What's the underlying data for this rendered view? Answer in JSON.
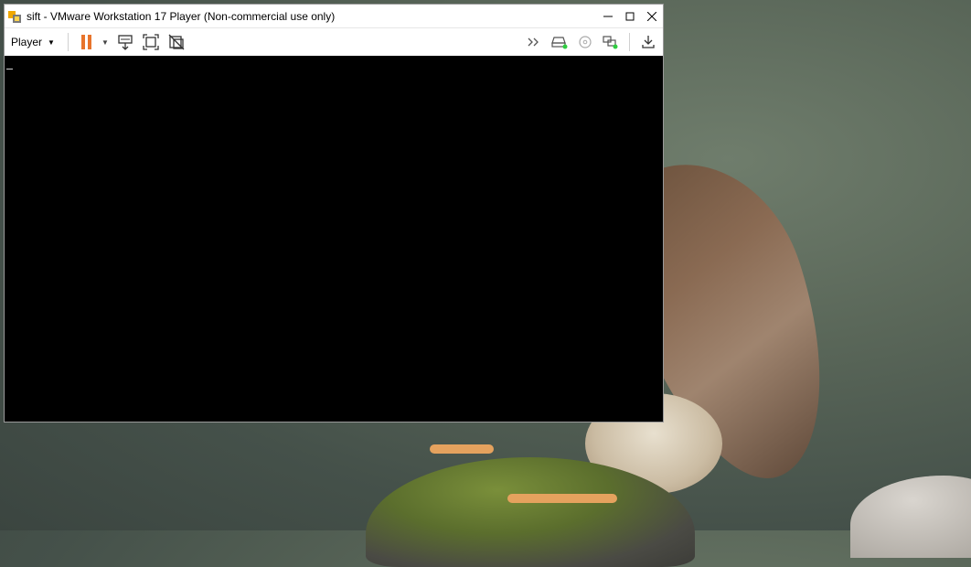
{
  "window": {
    "title": "sift - VMware Workstation 17 Player (Non-commercial use only)",
    "controls": {
      "minimize": "—",
      "maximize": "☐",
      "close": "✕"
    }
  },
  "toolbar": {
    "player_menu_label": "Player",
    "icons": [
      "pause-icon",
      "power-dropdown-icon",
      "send-ctrl-alt-del-icon",
      "fit-window-icon",
      "unity-icon",
      "expand-devices-icon",
      "hard-disk-icon",
      "cd-dvd-icon",
      "network-adapter-icon",
      "download-icon"
    ],
    "pause_color": "#e8742c",
    "device_active_color": "#2ecc40"
  },
  "vm_screen": {
    "background": "#000000"
  }
}
